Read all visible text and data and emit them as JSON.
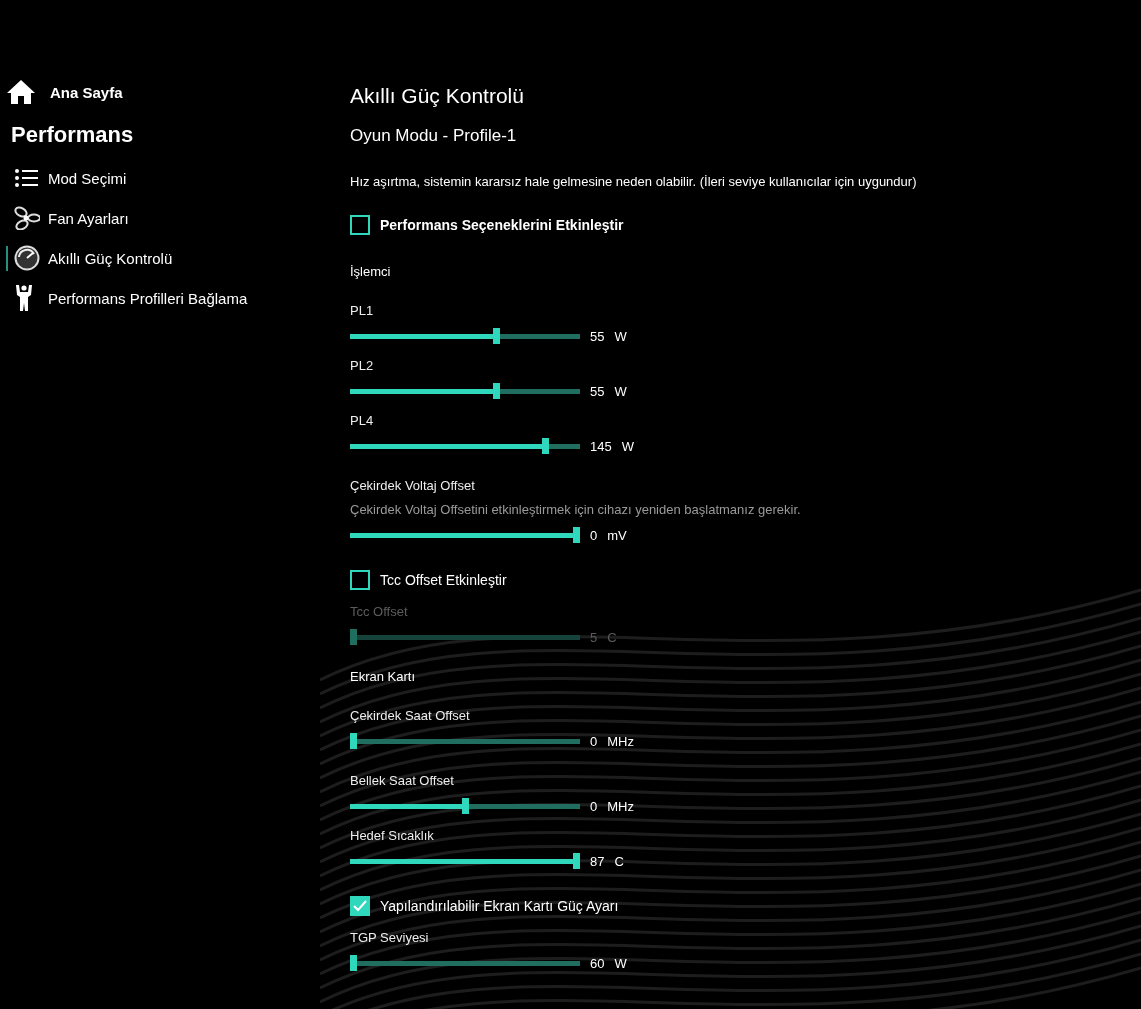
{
  "sidebar": {
    "home": "Ana Sayfa",
    "heading": "Performans",
    "items": [
      {
        "label": "Mod Seçimi",
        "kind": "list",
        "selected": false
      },
      {
        "label": "Fan Ayarları",
        "kind": "fan",
        "selected": false
      },
      {
        "label": "Akıllı Güç Kontrolü",
        "kind": "gauge",
        "selected": true
      },
      {
        "label": "Performans Profilleri Bağlama",
        "kind": "figure",
        "selected": false
      }
    ]
  },
  "page": {
    "title": "Akıllı Güç Kontrolü",
    "subtitle": "Oyun Modu - Profile-1"
  },
  "items": [
    {
      "kind": "note",
      "text": "Hız aşırtma, sistemin kararsız hale gelmesine neden olabilir. (İleri seviye kullanıcılar için uygundur)"
    },
    {
      "kind": "checkbox",
      "label": "Performans Seçeneklerini Etkinleştir",
      "checked": false,
      "bold": true
    },
    {
      "kind": "section",
      "text": "İşlemci"
    },
    {
      "kind": "slider",
      "label": "PL1",
      "level": 0.64,
      "value": "55",
      "unit": "W",
      "disabled": false
    },
    {
      "kind": "slider",
      "label": "PL2",
      "level": 0.64,
      "value": "55",
      "unit": "W",
      "disabled": false
    },
    {
      "kind": "slider",
      "label": "PL4",
      "level": 0.86,
      "value": "145",
      "unit": "W",
      "disabled": false
    },
    {
      "kind": "slider",
      "label": "Çekirdek Voltaj Offset",
      "hint": "Çekirdek Voltaj Offsetini etkinleştirmek için cihazı yeniden başlatmanız gerekir.",
      "level": 1,
      "value": "0",
      "unit": "mV",
      "disabled": false
    },
    {
      "kind": "checkbox",
      "label": "Tcc Offset Etkinleştir",
      "checked": false,
      "bold": false
    },
    {
      "kind": "slider",
      "label": "Tcc Offset",
      "level": 0,
      "value": "5",
      "unit": "C",
      "disabled": true
    },
    {
      "kind": "section",
      "text": "Ekran Kartı"
    },
    {
      "kind": "slider",
      "label": "Çekirdek Saat Offset",
      "level": 0,
      "value": "0",
      "unit": "MHz",
      "disabled": false
    },
    {
      "kind": "slider",
      "label": "Bellek Saat Offset",
      "level": 0.5,
      "value": "0",
      "unit": "MHz",
      "disabled": false
    },
    {
      "kind": "slider",
      "label": "Hedef Sıcaklık",
      "level": 1,
      "value": "87",
      "unit": "C",
      "disabled": false
    },
    {
      "kind": "checkbox",
      "label": "Yapılandırılabilir Ekran Kartı Güç Ayarı",
      "checked": true,
      "bold": false
    },
    {
      "kind": "slider",
      "label": "TGP Seviyesi",
      "level": 0,
      "value": "60",
      "unit": "W",
      "disabled": false
    }
  ]
}
